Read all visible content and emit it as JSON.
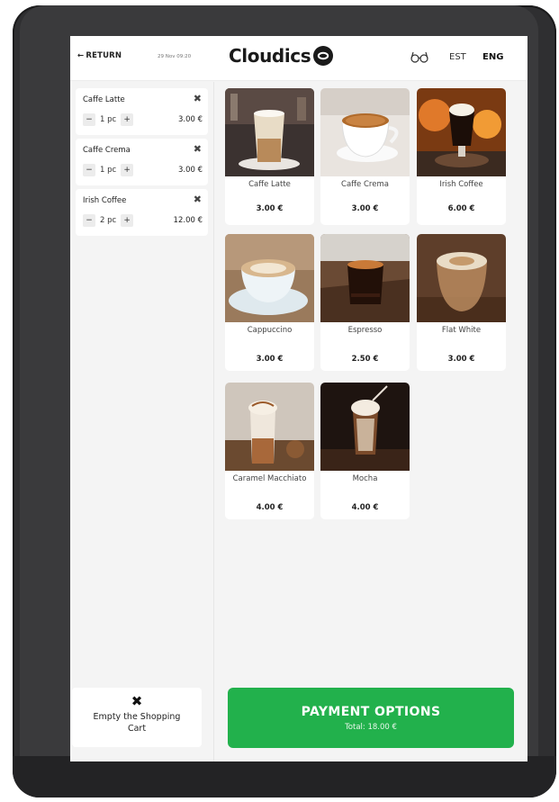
{
  "header": {
    "return_label": "RETURN",
    "date": "29 Nov 09:20",
    "logo_text": "Cloudics",
    "lang_est": "EST",
    "lang_eng": "ENG"
  },
  "cart": {
    "items": [
      {
        "name": "Caffe Latte",
        "qty": "1 pc",
        "price": "3.00 €"
      },
      {
        "name": "Caffe Crema",
        "qty": "1 pc",
        "price": "3.00 €"
      },
      {
        "name": "Irish Coffee",
        "qty": "2 pc",
        "price": "12.00 €"
      }
    ],
    "empty_label": "Empty the Shopping Cart"
  },
  "products": [
    {
      "name": "Caffe Latte",
      "price": "3.00 €"
    },
    {
      "name": "Caffe Crema",
      "price": "3.00 €"
    },
    {
      "name": "Irish Coffee",
      "price": "6.00 €"
    },
    {
      "name": "Cappuccino",
      "price": "3.00 €"
    },
    {
      "name": "Espresso",
      "price": "2.50 €"
    },
    {
      "name": "Flat White",
      "price": "3.00 €"
    },
    {
      "name": "Caramel Macchiato",
      "price": "4.00 €"
    },
    {
      "name": "Mocha",
      "price": "4.00 €"
    }
  ],
  "payment": {
    "label": "PAYMENT OPTIONS",
    "total": "Total: 18.00 €"
  },
  "colors": {
    "accent_green": "#22b14c",
    "frame": "#2f2f31",
    "screen_bg": "#f4f4f4"
  },
  "icons": [
    "arrow-left-icon",
    "cloudics-logo-icon",
    "glasses-icon",
    "close-icon",
    "minus-icon",
    "plus-icon"
  ]
}
